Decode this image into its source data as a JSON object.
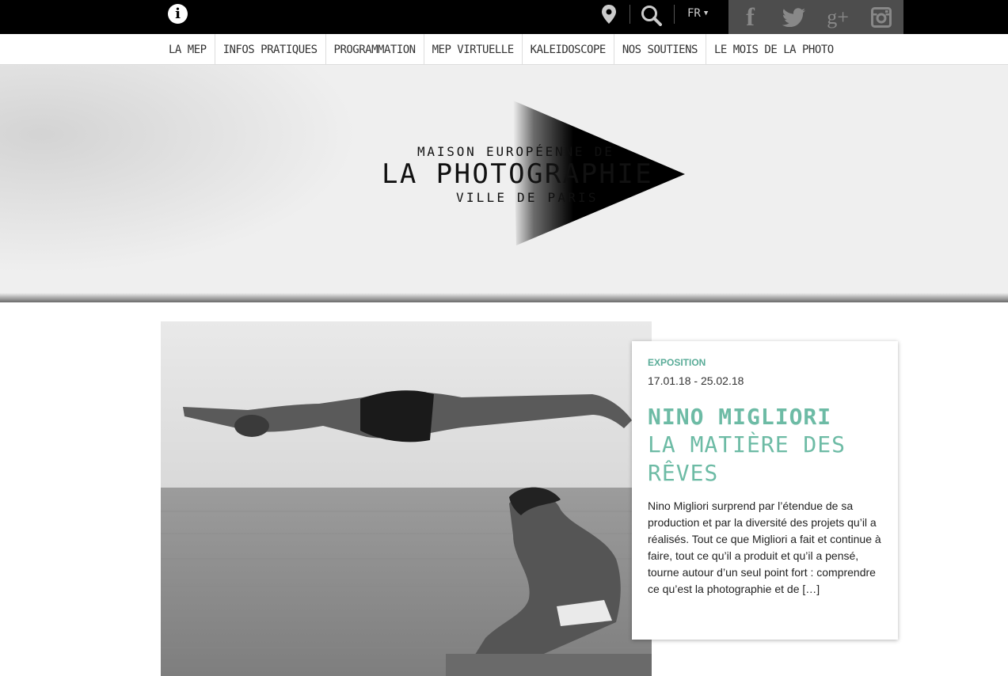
{
  "topbar": {
    "info_icon": "info-icon",
    "location_icon": "map-pin-icon",
    "search_icon": "search-icon",
    "language": "FR",
    "social": [
      "facebook-icon",
      "twitter-icon",
      "google-plus-icon",
      "instagram-icon"
    ]
  },
  "nav": {
    "items": [
      {
        "label": "LA MEP"
      },
      {
        "label": "INFOS PRATIQUES"
      },
      {
        "label": "PROGRAMMATION"
      },
      {
        "label": "MEP VIRTUELLE"
      },
      {
        "label": "KALEIDOSCOPE"
      },
      {
        "label": "NOS SOUTIENS"
      },
      {
        "label": "LE MOIS DE LA PHOTO"
      }
    ]
  },
  "logo": {
    "line1": "MAISON EUROPÉENNE DE",
    "line2": "LA PHOTOGRAPHIE",
    "line3": "VILLE DE PARIS"
  },
  "feature": {
    "category": "EXPOSITION",
    "dates": "17.01.18 - 25.02.18",
    "artist": "NINO MIGLIORI",
    "title": "LA MATIÈRE DES RÊVES",
    "excerpt": "Nino Migliori surprend par l’étendue de sa production et par la diversité des projets qu’il a réalisés. Tout ce que Migliori a fait et continue à faire, tout ce qu’il a produit et qu’il a pensé, tourne autour d’un seul point fort : comprendre ce qu’est la photographie et de […]"
  },
  "colors": {
    "accent": "#6dbba5",
    "topbar": "#000000",
    "social_bg": "#4d4d4d"
  }
}
